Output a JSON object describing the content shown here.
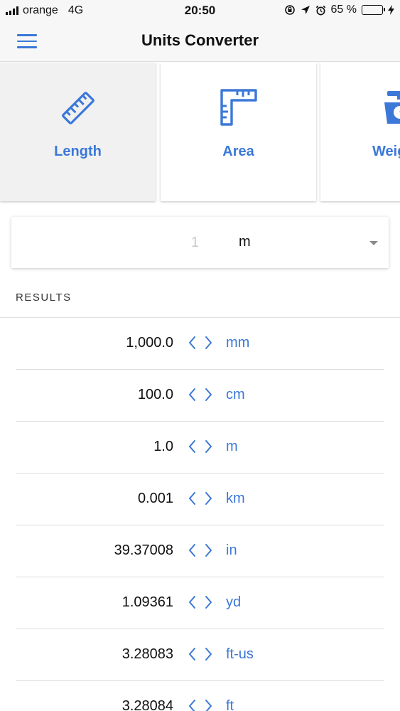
{
  "status_bar": {
    "carrier": "orange",
    "network": "4G",
    "time": "20:50",
    "battery_percent": "65 %",
    "battery_level": 0.65
  },
  "nav": {
    "title": "Units Converter"
  },
  "categories": [
    {
      "label": "Length",
      "icon": "ruler-icon",
      "active": true
    },
    {
      "label": "Area",
      "icon": "area-ruler-icon",
      "active": false
    },
    {
      "label": "Weight",
      "icon": "scale-icon",
      "active": false
    }
  ],
  "input": {
    "placeholder": "1",
    "unit": "m"
  },
  "results": {
    "header": "RESULTS",
    "rows": [
      {
        "value": "1,000.0",
        "unit": "mm"
      },
      {
        "value": "100.0",
        "unit": "cm"
      },
      {
        "value": "1.0",
        "unit": "m"
      },
      {
        "value": "0.001",
        "unit": "km"
      },
      {
        "value": "39.37008",
        "unit": "in"
      },
      {
        "value": "1.09361",
        "unit": "yd"
      },
      {
        "value": "3.28083",
        "unit": "ft-us"
      },
      {
        "value": "3.28084",
        "unit": "ft"
      }
    ]
  },
  "colors": {
    "accent": "#3b78d8",
    "battery_fill": "#4cd964"
  }
}
